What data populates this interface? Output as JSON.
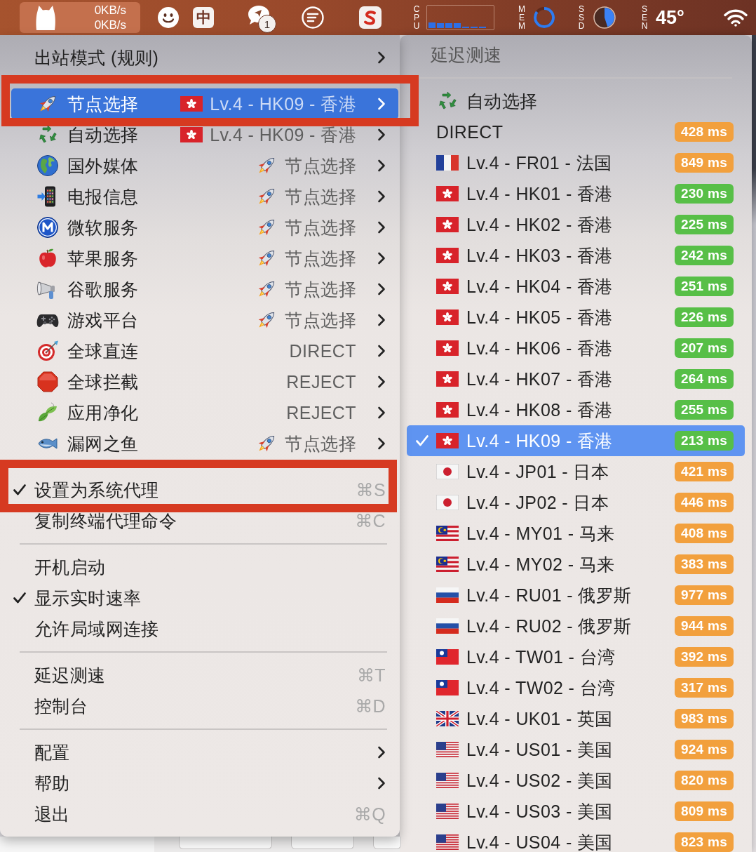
{
  "menu_bar": {
    "speeds": [
      "0KB/s",
      "0KB/s"
    ],
    "input_method": "中",
    "notification_count": "1",
    "cpu": {
      "label": "CPU"
    },
    "memory": {
      "label": "MEM",
      "level": 0.85
    },
    "disk": {
      "label": "SSD",
      "level": 0.45
    },
    "sensor": {
      "label": "SEN",
      "reading": "45°"
    }
  },
  "menu": {
    "items": [
      {
        "kind": "submenu",
        "label": "出站模式 (规则)",
        "selected": false,
        "outlined": false
      },
      {
        "kind": "separator"
      },
      {
        "kind": "group",
        "label": "节点选择",
        "value": {
          "kind": "node",
          "label": "Lv.4 - HK09 - 香港"
        },
        "selected": true,
        "outlined": true
      },
      {
        "kind": "group",
        "label": "自动选择",
        "value": {
          "kind": "node",
          "label": "Lv.4 - HK09 - 香港"
        },
        "selected": false,
        "outlined": false
      },
      {
        "kind": "group",
        "label": "国外媒体",
        "value": {
          "kind": "group",
          "label": "节点选择"
        },
        "selected": false,
        "outlined": false
      },
      {
        "kind": "group",
        "label": "电报信息",
        "value": {
          "kind": "group",
          "label": "节点选择"
        },
        "selected": false,
        "outlined": false
      },
      {
        "kind": "group",
        "label": "微软服务",
        "value": {
          "kind": "group",
          "label": "节点选择"
        },
        "selected": false,
        "outlined": false
      },
      {
        "kind": "group",
        "label": "苹果服务",
        "value": {
          "kind": "group",
          "label": "节点选择"
        },
        "selected": false,
        "outlined": false
      },
      {
        "kind": "group",
        "label": "谷歌服务",
        "value": {
          "kind": "group",
          "label": "节点选择"
        },
        "selected": false,
        "outlined": false
      },
      {
        "kind": "group",
        "label": "游戏平台",
        "value": {
          "kind": "group",
          "label": "节点选择"
        },
        "selected": false,
        "outlined": false
      },
      {
        "kind": "group",
        "label": "全球直连",
        "value": {
          "kind": "policy",
          "label": "DIRECT"
        },
        "selected": false,
        "outlined": false
      },
      {
        "kind": "group",
        "label": "全球拦截",
        "value": {
          "kind": "policy",
          "label": "REJECT"
        },
        "selected": false,
        "outlined": false
      },
      {
        "kind": "group",
        "label": "应用净化",
        "value": {
          "kind": "policy",
          "label": "REJECT"
        },
        "selected": false,
        "outlined": false
      },
      {
        "kind": "group",
        "label": "漏网之鱼",
        "value": {
          "kind": "group",
          "label": "节点选择"
        },
        "selected": false,
        "outlined": false
      },
      {
        "kind": "separator"
      },
      {
        "kind": "toggle",
        "label": "设置为系统代理",
        "checked": true,
        "shortcut": "⌘S",
        "selected": false,
        "outlined": true
      },
      {
        "kind": "action",
        "label": "复制终端代理命令",
        "shortcut": "⌘C",
        "selected": false,
        "outlined": false
      },
      {
        "kind": "separator"
      },
      {
        "kind": "toggle",
        "label": "开机启动",
        "checked": false,
        "selected": false,
        "outlined": false
      },
      {
        "kind": "toggle",
        "label": "显示实时速率",
        "checked": true,
        "selected": false,
        "outlined": false
      },
      {
        "kind": "toggle",
        "label": "允许局域网连接",
        "checked": false,
        "selected": false,
        "outlined": false
      },
      {
        "kind": "separator"
      },
      {
        "kind": "action",
        "label": "延迟测速",
        "shortcut": "⌘T",
        "selected": false,
        "outlined": false
      },
      {
        "kind": "action",
        "label": "控制台",
        "shortcut": "⌘D",
        "selected": false,
        "outlined": false
      },
      {
        "kind": "separator"
      },
      {
        "kind": "submenu",
        "label": "配置",
        "selected": false,
        "outlined": false
      },
      {
        "kind": "submenu",
        "label": "帮助",
        "selected": false,
        "outlined": false
      },
      {
        "kind": "action",
        "label": "退出",
        "shortcut": "⌘Q",
        "selected": false,
        "outlined": false
      }
    ]
  },
  "submenu": {
    "title": "延迟测速",
    "items": [
      {
        "kind": "group",
        "label": "自动选择",
        "selected": false
      },
      {
        "kind": "policy",
        "label": "DIRECT",
        "latency": "428 ms",
        "color": "#f2a03d",
        "selected": false
      },
      {
        "kind": "node",
        "label": "Lv.4 - FR01 - 法国",
        "latency": "849 ms",
        "color": "#f2a03d",
        "selected": false
      },
      {
        "kind": "node",
        "label": "Lv.4 - HK01 - 香港",
        "latency": "230 ms",
        "color": "#57bf47",
        "selected": false
      },
      {
        "kind": "node",
        "label": "Lv.4 - HK02 - 香港",
        "latency": "225 ms",
        "color": "#57bf47",
        "selected": false
      },
      {
        "kind": "node",
        "label": "Lv.4 - HK03 - 香港",
        "latency": "242 ms",
        "color": "#57bf47",
        "selected": false
      },
      {
        "kind": "node",
        "label": "Lv.4 - HK04 - 香港",
        "latency": "251 ms",
        "color": "#57bf47",
        "selected": false
      },
      {
        "kind": "node",
        "label": "Lv.4 - HK05 - 香港",
        "latency": "226 ms",
        "color": "#57bf47",
        "selected": false
      },
      {
        "kind": "node",
        "label": "Lv.4 - HK06 - 香港",
        "latency": "207 ms",
        "color": "#57bf47",
        "selected": false
      },
      {
        "kind": "node",
        "label": "Lv.4 - HK07 - 香港",
        "latency": "264 ms",
        "color": "#57bf47",
        "selected": false
      },
      {
        "kind": "node",
        "label": "Lv.4 - HK08 - 香港",
        "latency": "255 ms",
        "color": "#57bf47",
        "selected": false
      },
      {
        "kind": "node",
        "label": "Lv.4 - HK09 - 香港",
        "latency": "213 ms",
        "color": "#57bf47",
        "selected": true
      },
      {
        "kind": "node",
        "label": "Lv.4 - JP01 - 日本",
        "latency": "421 ms",
        "color": "#f2a03d",
        "selected": false
      },
      {
        "kind": "node",
        "label": "Lv.4 - JP02 - 日本",
        "latency": "446 ms",
        "color": "#f2a03d",
        "selected": false
      },
      {
        "kind": "node",
        "label": "Lv.4 - MY01 - 马来",
        "latency": "408 ms",
        "color": "#f2a03d",
        "selected": false
      },
      {
        "kind": "node",
        "label": "Lv.4 - MY02 - 马来",
        "latency": "383 ms",
        "color": "#f2a03d",
        "selected": false
      },
      {
        "kind": "node",
        "label": "Lv.4 - RU01 - 俄罗斯",
        "latency": "977 ms",
        "color": "#f2a03d",
        "selected": false
      },
      {
        "kind": "node",
        "label": "Lv.4 - RU02 - 俄罗斯",
        "latency": "944 ms",
        "color": "#f2a03d",
        "selected": false
      },
      {
        "kind": "node",
        "label": "Lv.4 - TW01 - 台湾",
        "latency": "392 ms",
        "color": "#f2a03d",
        "selected": false
      },
      {
        "kind": "node",
        "label": "Lv.4 - TW02 - 台湾",
        "latency": "317 ms",
        "color": "#f2a03d",
        "selected": false
      },
      {
        "kind": "node",
        "label": "Lv.4 - UK01 - 英国",
        "latency": "983 ms",
        "color": "#f2a03d",
        "selected": false
      },
      {
        "kind": "node",
        "label": "Lv.4 - US01 - 美国",
        "latency": "924 ms",
        "color": "#f2a03d",
        "selected": false
      },
      {
        "kind": "node",
        "label": "Lv.4 - US02 - 美国",
        "latency": "820 ms",
        "color": "#f2a03d",
        "selected": false
      },
      {
        "kind": "node",
        "label": "Lv.4 - US03 - 美国",
        "latency": "809 ms",
        "color": "#f2a03d",
        "selected": false
      },
      {
        "kind": "node",
        "label": "Lv.4 - US04 - 美国",
        "latency": "823 ms",
        "color": "#f2a03d",
        "selected": false
      }
    ]
  }
}
